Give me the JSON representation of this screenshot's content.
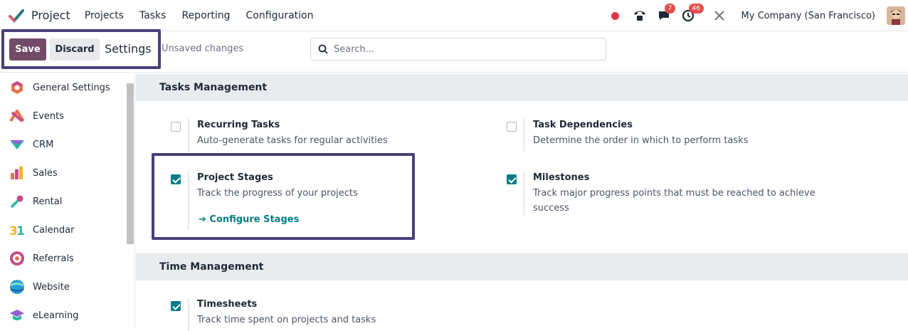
{
  "navbar": {
    "app_name": "Project",
    "menu": [
      "Projects",
      "Tasks",
      "Reporting",
      "Configuration"
    ],
    "chat_badge": "7",
    "activity_badge": "46",
    "company": "My Company (San Francisco)"
  },
  "control": {
    "save_label": "Save",
    "discard_label": "Discard",
    "title": "Settings",
    "status": "Unsaved changes",
    "search_placeholder": "Search..."
  },
  "sidebar": {
    "items": [
      {
        "label": "General Settings",
        "icon": "general-settings-icon"
      },
      {
        "label": "Events",
        "icon": "events-icon"
      },
      {
        "label": "CRM",
        "icon": "crm-icon"
      },
      {
        "label": "Sales",
        "icon": "sales-icon"
      },
      {
        "label": "Rental",
        "icon": "rental-icon"
      },
      {
        "label": "Calendar",
        "icon": "calendar-icon"
      },
      {
        "label": "Referrals",
        "icon": "referrals-icon"
      },
      {
        "label": "Website",
        "icon": "website-icon"
      },
      {
        "label": "eLearning",
        "icon": "elearning-icon"
      }
    ]
  },
  "sections": {
    "tasks": {
      "title": "Tasks Management",
      "recurring": {
        "title": "Recurring Tasks",
        "desc": "Auto-generate tasks for regular activities",
        "checked": false
      },
      "dependencies": {
        "title": "Task Dependencies",
        "desc": "Determine the order in which to perform tasks",
        "checked": false
      },
      "stages": {
        "title": "Project Stages",
        "desc": "Track the progress of your projects",
        "link": "Configure Stages",
        "checked": true
      },
      "milestones": {
        "title": "Milestones",
        "desc": "Track major progress points that must be reached to achieve success",
        "checked": true
      }
    },
    "time": {
      "title": "Time Management",
      "timesheets": {
        "title": "Timesheets",
        "desc": "Track time spent on projects and tasks",
        "checked": true
      }
    }
  },
  "colors": {
    "primary": "#714b67",
    "accent": "#017e84",
    "highlight": "#4b3f7a"
  }
}
